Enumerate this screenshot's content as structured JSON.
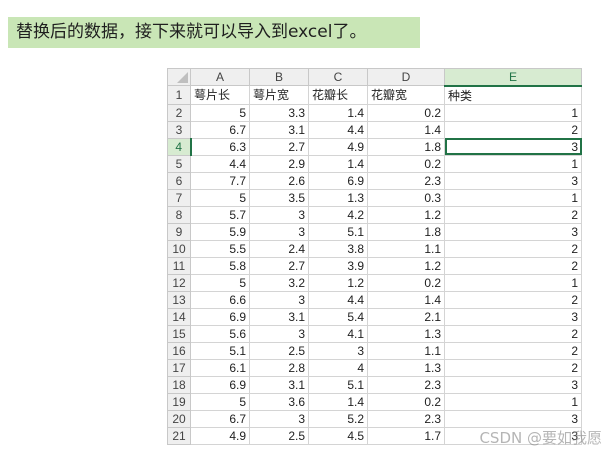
{
  "caption": "替换后的数据，接下来就可以导入到excel了。",
  "watermark": "CSDN @要如我愿",
  "columns": [
    "A",
    "B",
    "C",
    "D",
    "E"
  ],
  "selected_column": "E",
  "active_cell": "E4",
  "rows": [
    {
      "row": "1",
      "cells": [
        "萼片长",
        "萼片宽",
        "花瓣长",
        "花瓣宽",
        "种类"
      ]
    },
    {
      "row": "2",
      "cells": [
        "5",
        "3.3",
        "1.4",
        "0.2",
        "1"
      ]
    },
    {
      "row": "3",
      "cells": [
        "6.7",
        "3.1",
        "4.4",
        "1.4",
        "2"
      ]
    },
    {
      "row": "4",
      "cells": [
        "6.3",
        "2.7",
        "4.9",
        "1.8",
        "3"
      ]
    },
    {
      "row": "5",
      "cells": [
        "4.4",
        "2.9",
        "1.4",
        "0.2",
        "1"
      ]
    },
    {
      "row": "6",
      "cells": [
        "7.7",
        "2.6",
        "6.9",
        "2.3",
        "3"
      ]
    },
    {
      "row": "7",
      "cells": [
        "5",
        "3.5",
        "1.3",
        "0.3",
        "1"
      ]
    },
    {
      "row": "8",
      "cells": [
        "5.7",
        "3",
        "4.2",
        "1.2",
        "2"
      ]
    },
    {
      "row": "9",
      "cells": [
        "5.9",
        "3",
        "5.1",
        "1.8",
        "3"
      ]
    },
    {
      "row": "10",
      "cells": [
        "5.5",
        "2.4",
        "3.8",
        "1.1",
        "2"
      ]
    },
    {
      "row": "11",
      "cells": [
        "5.8",
        "2.7",
        "3.9",
        "1.2",
        "2"
      ]
    },
    {
      "row": "12",
      "cells": [
        "5",
        "3.2",
        "1.2",
        "0.2",
        "1"
      ]
    },
    {
      "row": "13",
      "cells": [
        "6.6",
        "3",
        "4.4",
        "1.4",
        "2"
      ]
    },
    {
      "row": "14",
      "cells": [
        "6.9",
        "3.1",
        "5.4",
        "2.1",
        "3"
      ]
    },
    {
      "row": "15",
      "cells": [
        "5.6",
        "3",
        "4.1",
        "1.3",
        "2"
      ]
    },
    {
      "row": "16",
      "cells": [
        "5.1",
        "2.5",
        "3",
        "1.1",
        "2"
      ]
    },
    {
      "row": "17",
      "cells": [
        "6.1",
        "2.8",
        "4",
        "1.3",
        "2"
      ]
    },
    {
      "row": "18",
      "cells": [
        "6.9",
        "3.1",
        "5.1",
        "2.3",
        "3"
      ]
    },
    {
      "row": "19",
      "cells": [
        "5",
        "3.6",
        "1.4",
        "0.2",
        "1"
      ]
    },
    {
      "row": "20",
      "cells": [
        "6.7",
        "3",
        "5.2",
        "2.3",
        "3"
      ]
    },
    {
      "row": "21",
      "cells": [
        "4.9",
        "2.5",
        "4.5",
        "1.7",
        "3"
      ]
    }
  ]
}
